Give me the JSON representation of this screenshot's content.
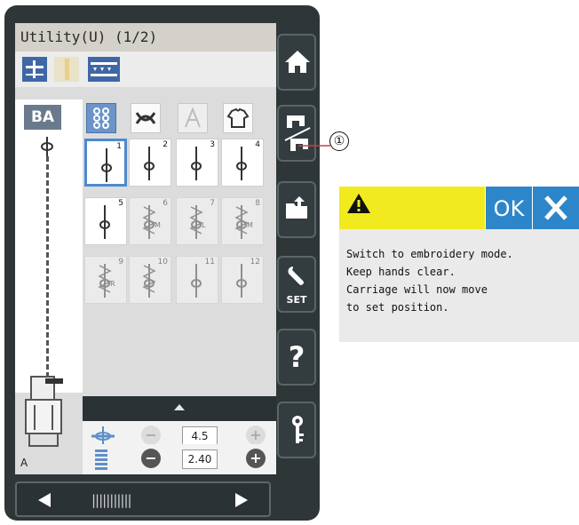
{
  "screen": {
    "title": "Utility(U) (1/2)",
    "left_panel": {
      "b_button_label": "BA",
      "presser_foot_label": "A"
    },
    "categories": [
      "utility-stitches-icon",
      "stretch-stitches-icon",
      "letters-icon",
      "garment-icon"
    ],
    "selected_category": 0,
    "stitches": [
      {
        "number": "1",
        "label": "",
        "selected": true,
        "enabled": true
      },
      {
        "number": "2",
        "label": "",
        "selected": false,
        "enabled": true
      },
      {
        "number": "3",
        "label": "",
        "selected": false,
        "enabled": true
      },
      {
        "number": "4",
        "label": "",
        "selected": false,
        "enabled": true
      },
      {
        "number": "5",
        "label": "",
        "selected": false,
        "enabled": true
      },
      {
        "number": "6",
        "label": "M",
        "selected": false,
        "enabled": false
      },
      {
        "number": "7",
        "label": "L",
        "selected": false,
        "enabled": false
      },
      {
        "number": "8",
        "label": "M",
        "selected": false,
        "enabled": false
      },
      {
        "number": "9",
        "label": "R",
        "selected": false,
        "enabled": false
      },
      {
        "number": "10",
        "label": "",
        "selected": false,
        "enabled": false
      },
      {
        "number": "11",
        "label": "",
        "selected": false,
        "enabled": false
      },
      {
        "number": "12",
        "label": "",
        "selected": false,
        "enabled": false
      }
    ],
    "settings": {
      "width_value": "4.5",
      "length_value": "2.40"
    }
  },
  "sidebar": {
    "buttons": [
      "home-icon",
      "mode-switch-icon",
      "open-file-icon",
      "set-icon",
      "help-icon",
      "key-icon"
    ],
    "set_label": "SET",
    "help_label": "?"
  },
  "callout": {
    "label": "①"
  },
  "dialog": {
    "ok_label": "OK",
    "message": "Switch to embroidery mode.\nKeep hands clear.\nCarriage will now move\nto set position."
  },
  "colors": {
    "ok_blue": "#2d86c9",
    "warning_yellow": "#f1ea1f",
    "device_dark": "#2e3638",
    "selected_blue": "#4c8ad0"
  }
}
